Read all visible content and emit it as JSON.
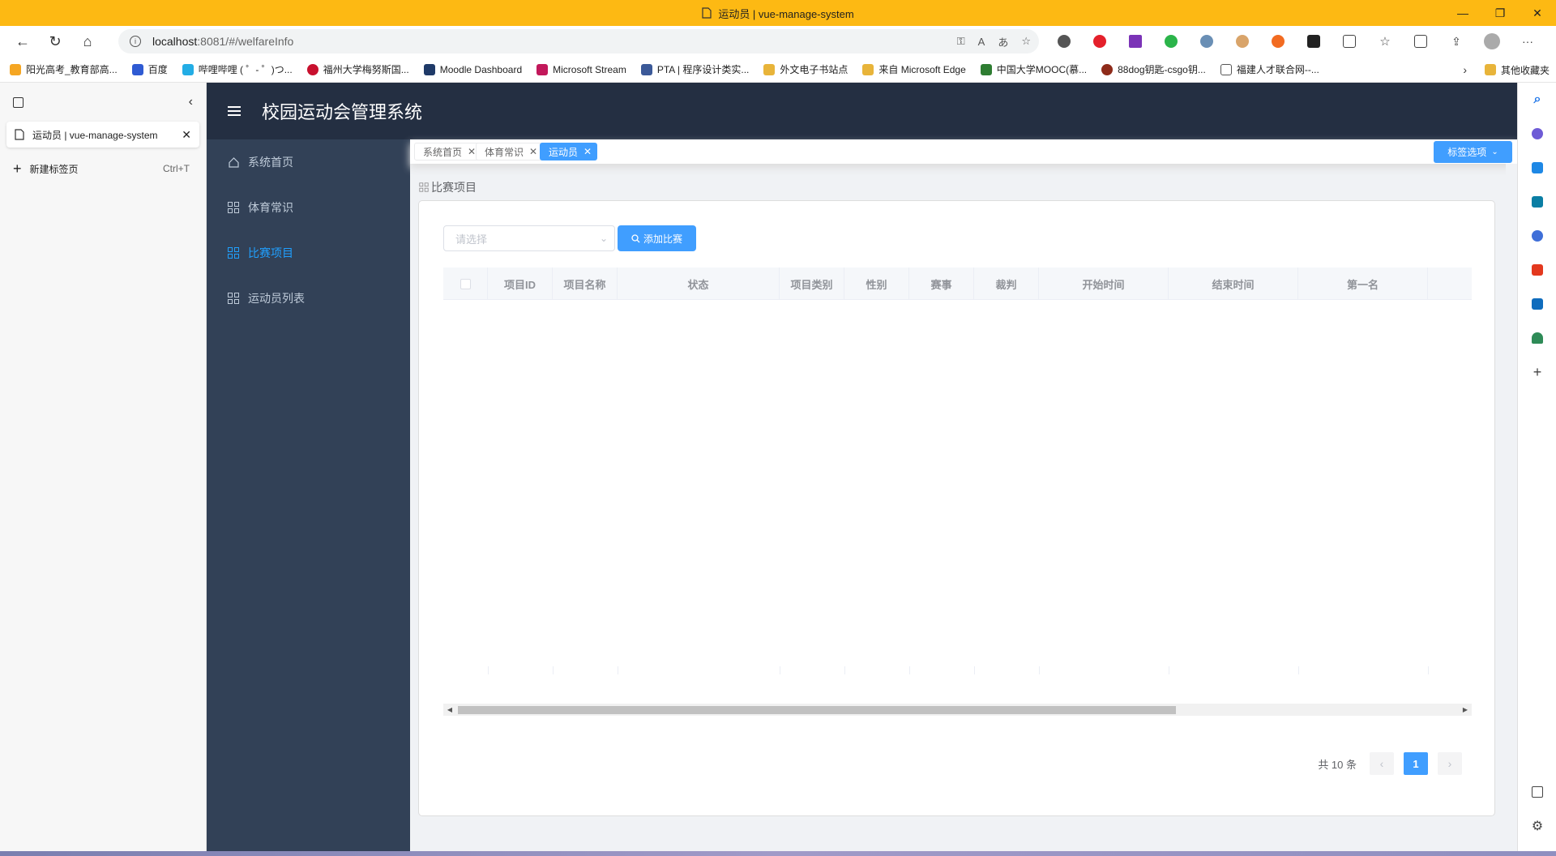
{
  "browser": {
    "window_title": "运动员 | vue-manage-system",
    "url_host": "localhost",
    "url_rest": ":8081/#/welfareInfo",
    "bookmarks": [
      "阳光高考_教育部高...",
      "百度",
      "哔哩哔哩 ( ゜- ゜)つ...",
      "福州大学梅努斯国...",
      "Moodle Dashboard",
      "Microsoft Stream",
      "PTA | 程序设计类实...",
      "外文电子书站点",
      "来自 Microsoft Edge",
      "中国大学MOOC(慕...",
      "88dog钥匙-csgo钥...",
      "福建人才联合网--..."
    ],
    "other_bookmarks": "其他收藏夹"
  },
  "tab_panel": {
    "current_tab": "运动员 | vue-manage-system",
    "new_tab": "新建标签页",
    "new_tab_shortcut": "Ctrl+T"
  },
  "app": {
    "title": "校园运动会管理系统",
    "sidebar": [
      {
        "label": "系统首页",
        "icon": "home-icon",
        "active": false
      },
      {
        "label": "体育常识",
        "icon": "grid-icon",
        "active": false
      },
      {
        "label": "比赛项目",
        "icon": "grid-icon",
        "active": true
      },
      {
        "label": "运动员列表",
        "icon": "grid-icon",
        "active": false
      }
    ],
    "tags": [
      {
        "label": "系统首页",
        "active": false
      },
      {
        "label": "体育常识",
        "active": false
      },
      {
        "label": "运动员",
        "active": true
      }
    ],
    "tag_options": "标签选项",
    "breadcrumb": "比赛项目",
    "filter": {
      "placeholder": "请选择",
      "add_button": "添加比赛"
    },
    "table": {
      "columns": [
        "项目ID",
        "项目名称",
        "状态",
        "项目类别",
        "性别",
        "赛事",
        "裁判",
        "开始时间",
        "结束时间",
        "第一名"
      ],
      "rows": []
    },
    "pagination": {
      "total_text": "共 10 条",
      "current_page": "1"
    }
  },
  "colors": {
    "header_bg": "#242f42",
    "sidebar_bg": "#324157",
    "accent": "#409eff",
    "titlebar": "#fdb913"
  }
}
